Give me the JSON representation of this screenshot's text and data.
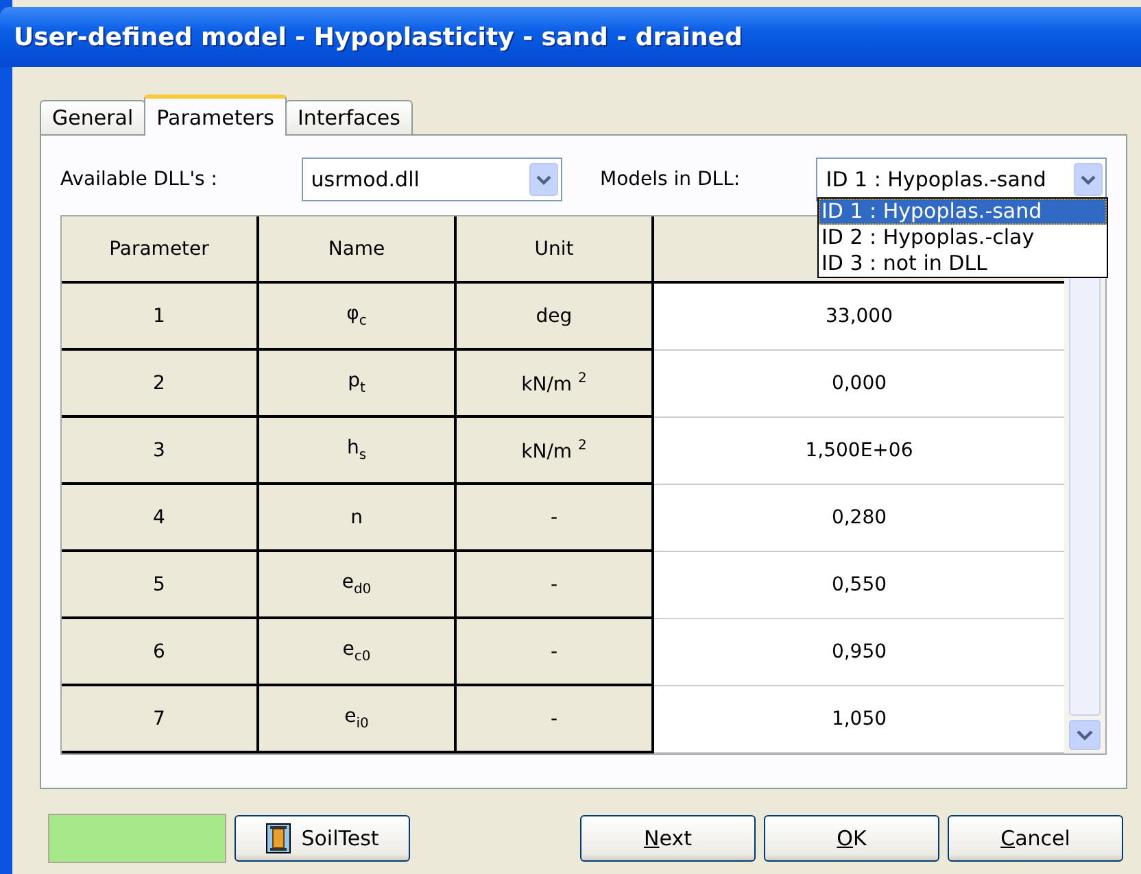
{
  "window": {
    "title": "User-defined model - Hypoplasticity - sand - drained"
  },
  "tabs": [
    {
      "label": "General",
      "selected": false
    },
    {
      "label": "Parameters",
      "selected": true
    },
    {
      "label": "Interfaces",
      "selected": false
    }
  ],
  "dll": {
    "label": "Available DLL's :",
    "value": "usrmod.dll"
  },
  "models": {
    "label": "Models in DLL:",
    "value": "ID 1 : Hypoplas.-sand",
    "expanded": true,
    "options": [
      {
        "label": "ID 1 : Hypoplas.-sand",
        "selected": true
      },
      {
        "label": "ID 2 : Hypoplas.-clay",
        "selected": false
      },
      {
        "label": "ID 3 : not in DLL",
        "selected": false
      }
    ]
  },
  "table": {
    "columns": [
      "Parameter",
      "Name",
      "Unit"
    ],
    "rows": [
      {
        "parameter": "1",
        "name": "φ$_{c}$",
        "unit": "deg",
        "value": "33,000"
      },
      {
        "parameter": "2",
        "name": "p$_{t}$",
        "unit": "kN/m $^{2}$",
        "value": "0,000"
      },
      {
        "parameter": "3",
        "name": "h$_{s}$",
        "unit": "kN/m $^{2}$",
        "value": "1,500E+06"
      },
      {
        "parameter": "4",
        "name": "n",
        "unit": "-",
        "value": "0,280"
      },
      {
        "parameter": "5",
        "name": "e$_{d0}$",
        "unit": "-",
        "value": "0,550"
      },
      {
        "parameter": "6",
        "name": "e$_{c0}$",
        "unit": "-",
        "value": "0,950"
      },
      {
        "parameter": "7",
        "name": "e$_{i0}$",
        "unit": "-",
        "value": "1,050"
      }
    ]
  },
  "status_swatch": {
    "color": "#a6e88a"
  },
  "soiltest_button": {
    "label": "SoilTest"
  },
  "buttons": [
    {
      "label": "Next",
      "underline_first": true
    },
    {
      "label": "OK",
      "underline_first": true
    },
    {
      "label": "Cancel",
      "underline_first": true
    }
  ]
}
